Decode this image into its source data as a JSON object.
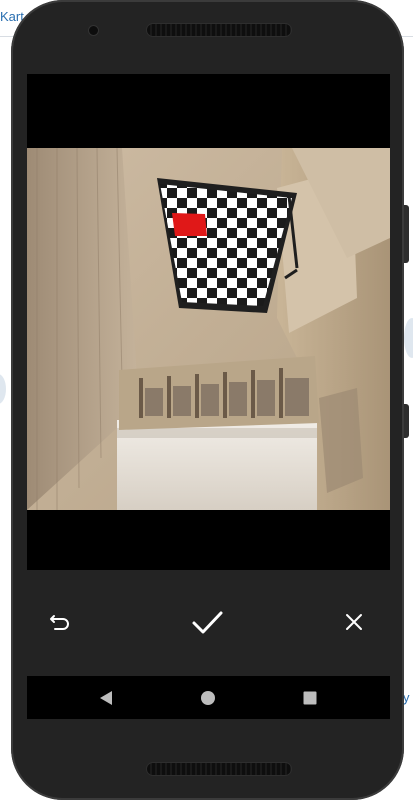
{
  "backdrop": {
    "left_fragment": "Kart",
    "right_fragment": "y"
  },
  "editor": {
    "toolbar": {
      "undo_icon": "undo-icon",
      "accept_icon": "check-icon",
      "cancel_icon": "close-icon"
    }
  },
  "navbar": {
    "back_icon": "back-triangle-icon",
    "home_icon": "home-circle-icon",
    "recents_icon": "recents-square-icon"
  },
  "colors": {
    "phone_body": "#232323",
    "screen_bg": "#000000",
    "icon": "#ffffff",
    "nav_icon": "#bdbdbd",
    "selection": "#e01818"
  }
}
